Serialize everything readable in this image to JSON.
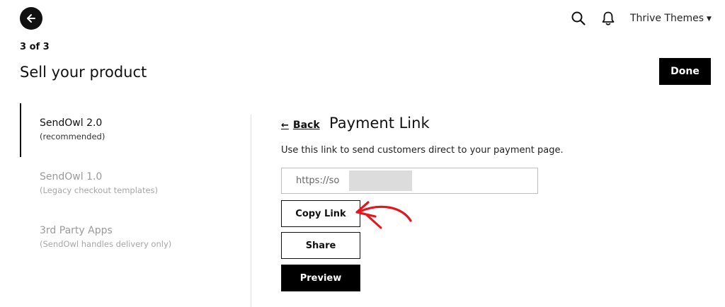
{
  "header": {
    "account_name": "Thrive Themes"
  },
  "wizard": {
    "step": "3 of 3",
    "title": "Sell your product",
    "done_label": "Done"
  },
  "sidebar": {
    "items": [
      {
        "name": "SendOwl 2.0",
        "sub": "(recommended)"
      },
      {
        "name": "SendOwl 1.0",
        "sub": "(Legacy checkout templates)"
      },
      {
        "name": "3rd Party Apps",
        "sub": "(SendOwl handles delivery only)"
      }
    ]
  },
  "panel": {
    "back_label": "Back",
    "title": "Payment Link",
    "description": "Use this link to send customers direct to your payment page.",
    "link_value": "https://so",
    "copy_label": "Copy Link",
    "share_label": "Share",
    "preview_label": "Preview"
  },
  "colors": {
    "primary": "#000000",
    "annotation": "#e8141b"
  },
  "icons": {
    "back": "arrow-left-icon",
    "search": "search-icon",
    "notifications": "bell-icon",
    "account_caret": "chevron-down-icon"
  }
}
